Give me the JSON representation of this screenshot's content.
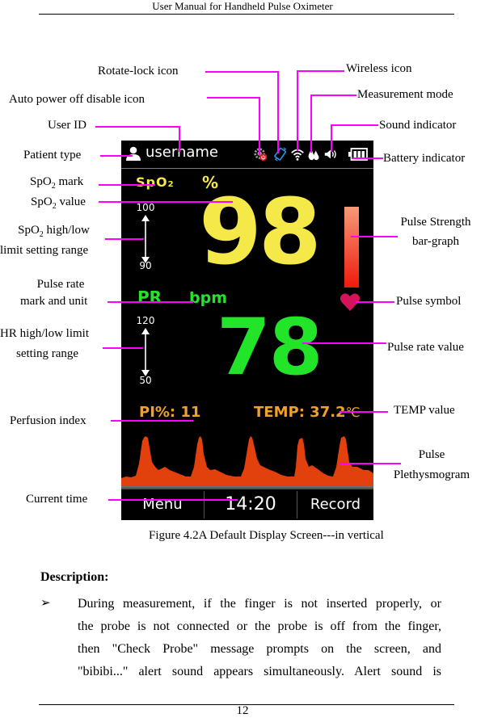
{
  "page": {
    "header_title": "User Manual for Handheld Pulse Oximeter",
    "page_number": "12"
  },
  "callouts": {
    "rotate_lock": "Rotate-lock icon",
    "auto_power_off": "Auto power off disable icon",
    "user_id": "User ID",
    "patient_type": "Patient type",
    "spo2_mark_pre": "SpO",
    "spo2_mark_sub": "2",
    "spo2_mark_post": " mark",
    "spo2_value_pre": "SpO",
    "spo2_value_sub": "2",
    "spo2_value_post": " value",
    "spo2_limit_l1_pre": "SpO",
    "spo2_limit_l1_sub": "2",
    "spo2_limit_l1_post": " high/low",
    "spo2_limit_l2": "limit setting range",
    "pr_mark_l1": "Pulse rate",
    "pr_mark_l2": "mark and unit",
    "hr_limit_l1": "HR high/low limit",
    "hr_limit_l2": "setting range",
    "perfusion_index": "Perfusion index",
    "current_time": "Current time",
    "wireless": "Wireless icon",
    "measurement_mode": "Measurement mode",
    "sound_indicator": "Sound indicator",
    "battery_indicator": "Battery indicator",
    "pulse_strength_l1": "Pulse Strength",
    "pulse_strength_l2": "bar-graph",
    "pulse_symbol": "Pulse symbol",
    "pulse_rate_value": "Pulse rate value",
    "temp_value": "TEMP value",
    "pleth_l1": "Pulse",
    "pleth_l2": "Plethysmogram"
  },
  "screen": {
    "username": "username",
    "status_icons": [
      "auto-power-off-disable-icon",
      "rotate-lock-icon",
      "wireless-icon",
      "measurement-mode-icon",
      "sound-icon",
      "battery-icon"
    ],
    "spo2": {
      "mark": "SpO",
      "mark_sub": "2",
      "unit": "%",
      "value": "98",
      "limit_high": "100",
      "limit_low": "90",
      "color": "#f5e94a"
    },
    "pulse_strength_fraction": 0.85,
    "pr": {
      "mark": "PR",
      "unit": "bpm",
      "value": "78",
      "limit_high": "120",
      "limit_low": "50",
      "color": "#22e52a"
    },
    "pi": {
      "label": "PI%:",
      "value": "11"
    },
    "temp": {
      "label": "TEMP",
      "sep": ":",
      "value": "37.2",
      "unit": "℃"
    },
    "bottom_bar": {
      "menu": "Menu",
      "time": "14:20",
      "record": "Record"
    },
    "accent_orange": "#f0a12c",
    "pleth_color": "#e2400c",
    "heart_color": "#d4145a"
  },
  "figure_caption": "Figure 4.2A Default Display Screen---in vertical",
  "description": {
    "heading": "Description:",
    "bullet": "➢",
    "lines": [
      "During measurement, if the finger is not inserted properly, or",
      "the probe is not connected or the probe is off from the finger,",
      "then \"Check Probe\" message prompts on the screen, and",
      "\"bibibi...\" alert sound appears simultaneously. Alert sound is"
    ]
  }
}
